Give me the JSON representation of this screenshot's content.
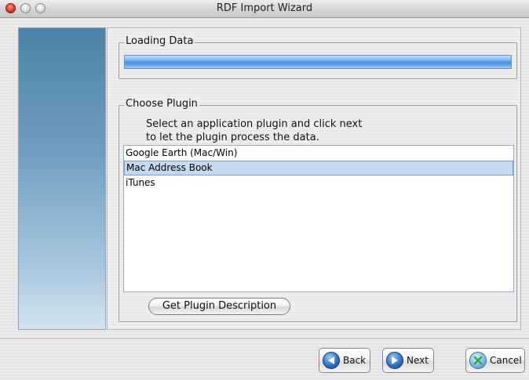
{
  "window": {
    "title": "RDF Import Wizard"
  },
  "loading": {
    "label": "Loading Data",
    "progress": 1.0
  },
  "plugin": {
    "label": "Choose Plugin",
    "instruction_line1": "Select an application plugin and click next",
    "instruction_line2": "to let the plugin process the data.",
    "items": [
      {
        "label": "Google Earth (Mac/Win)",
        "selected": false
      },
      {
        "label": "Mac Address Book",
        "selected": true
      },
      {
        "label": "iTunes",
        "selected": false
      }
    ],
    "description_button": "Get Plugin Description"
  },
  "buttons": {
    "back": "Back",
    "next": "Next",
    "cancel": "Cancel"
  },
  "icons": {
    "back": "back-arrow-icon",
    "next": "next-arrow-icon",
    "cancel": "cancel-x-icon"
  },
  "colors": {
    "accent": "#3f8fe6",
    "selection": "#c4d9f2"
  }
}
